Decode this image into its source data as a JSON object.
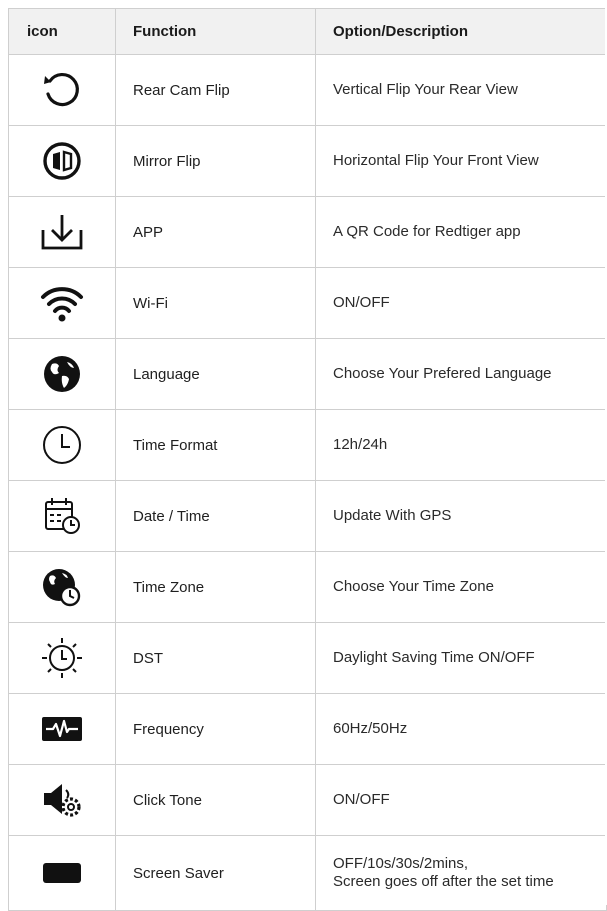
{
  "header": {
    "icon": "icon",
    "function": "Function",
    "description": "Option/Description"
  },
  "rows": [
    {
      "icon": "rotate-ccw-icon",
      "function": "Rear Cam Flip",
      "description": "Vertical Flip Your Rear View"
    },
    {
      "icon": "mirror-flip-icon",
      "function": "Mirror Flip",
      "description": "Horizontal Flip Your Front View"
    },
    {
      "icon": "download-icon",
      "function": "APP",
      "description": "A QR Code for Redtiger app"
    },
    {
      "icon": "wifi-icon",
      "function": "Wi-Fi",
      "description": "ON/OFF"
    },
    {
      "icon": "globe-icon",
      "function": "Language",
      "description": "Choose Your Prefered Language"
    },
    {
      "icon": "clock-icon",
      "function": "Time Format",
      "description": "12h/24h"
    },
    {
      "icon": "calendar-clock-icon",
      "function": "Date / Time",
      "description": "Update With GPS"
    },
    {
      "icon": "globe-clock-icon",
      "function": "Time Zone",
      "description": "Choose Your Time Zone"
    },
    {
      "icon": "sun-clock-icon",
      "function": "DST",
      "description": "Daylight Saving Time ON/OFF"
    },
    {
      "icon": "waveform-icon",
      "function": "Frequency",
      "description": "60Hz/50Hz"
    },
    {
      "icon": "speaker-gear-icon",
      "function": "Click Tone",
      "description": "ON/OFF"
    },
    {
      "icon": "screen-rect-icon",
      "function": "Screen Saver",
      "description_line1": "OFF/10s/30s/2mins,",
      "description_line2": "Screen goes off after the set time"
    }
  ]
}
